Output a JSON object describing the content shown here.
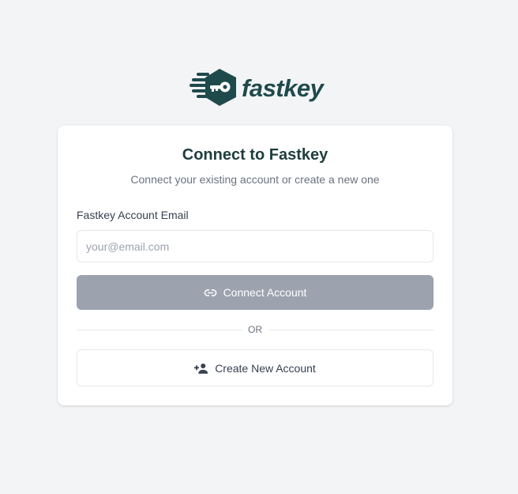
{
  "brand": {
    "name": "fastkey",
    "logo_icon": "key-hexagon-icon",
    "color": "#1f4a4c"
  },
  "card": {
    "title": "Connect to Fastkey",
    "subtitle": "Connect your existing account or create a new one"
  },
  "form": {
    "email_label": "Fastkey Account Email",
    "email_placeholder": "your@email.com",
    "email_value": ""
  },
  "actions": {
    "connect_label": "Connect Account",
    "connect_icon": "link-icon",
    "connect_disabled": true,
    "divider_text": "OR",
    "create_label": "Create New Account",
    "create_icon": "person-add-icon"
  },
  "colors": {
    "background": "#f3f4f6",
    "title": "#1f3d3e",
    "button_disabled": "#9ca3af"
  }
}
